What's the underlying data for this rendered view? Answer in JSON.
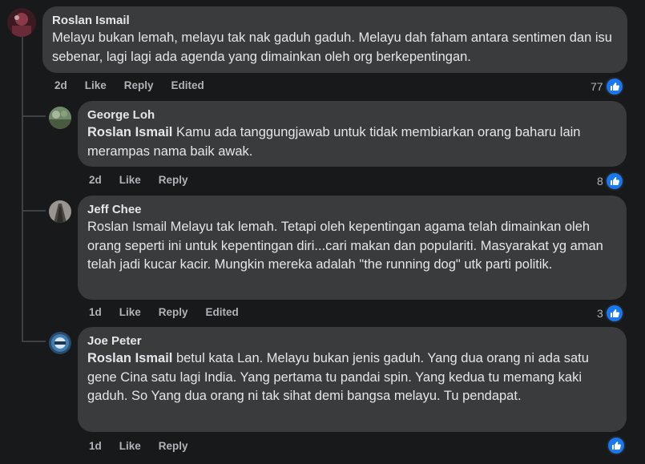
{
  "comments": [
    {
      "author": "Roslan Ismail",
      "tag": "",
      "text": "Melayu bukan lemah, melayu tak nak gaduh gaduh. Melayu dah faham antara sentimen dan isu sebenar, lagi lagi ada agenda yang dimainkan oleh org berkepentingan.",
      "time": "2d",
      "like": "Like",
      "reply": "Reply",
      "edited": "Edited",
      "reaction_count": "77"
    },
    {
      "author": "George Loh",
      "tag": "Roslan Ismail",
      "text": " Kamu ada tanggungjawab untuk tidak membiarkan orang baharu lain merampas nama baik awak.",
      "time": "2d",
      "like": "Like",
      "reply": "Reply",
      "edited": "",
      "reaction_count": "8"
    },
    {
      "author": "Jeff Chee",
      "tag": "",
      "text": "Roslan Ismail Melayu tak lemah. Tetapi oleh kepentingan agama telah dimainkan oleh orang seperti ini untuk kepentingan diri...cari makan dan populariti. Masyarakat yg aman telah jadi kucar kacir. Mungkin mereka adalah \"the running dog\" utk parti politik.",
      "time": "1d",
      "like": "Like",
      "reply": "Reply",
      "edited": "Edited",
      "reaction_count": "3"
    },
    {
      "author": "Joe Peter",
      "tag": "Roslan Ismail",
      "text": " betul kata Lan. Melayu bukan jenis gaduh. Yang dua orang ni ada satu gene Cina satu lagi India. Yang pertama tu pandai spin. Yang kedua tu memang kaki gaduh. So Yang dua orang ni tak sihat demi bangsa melayu. Tu pendapat.",
      "time": "1d",
      "like": "Like",
      "reply": "Reply",
      "edited": "",
      "reaction_count": ""
    }
  ],
  "colors": {
    "background": "#18191a",
    "bubble": "#3a3b3c",
    "text": "#e4e6eb",
    "meta": "#b0b3b8",
    "like_blue": "#1877f2"
  },
  "icons": {
    "reaction": "thumbs-up-icon"
  }
}
